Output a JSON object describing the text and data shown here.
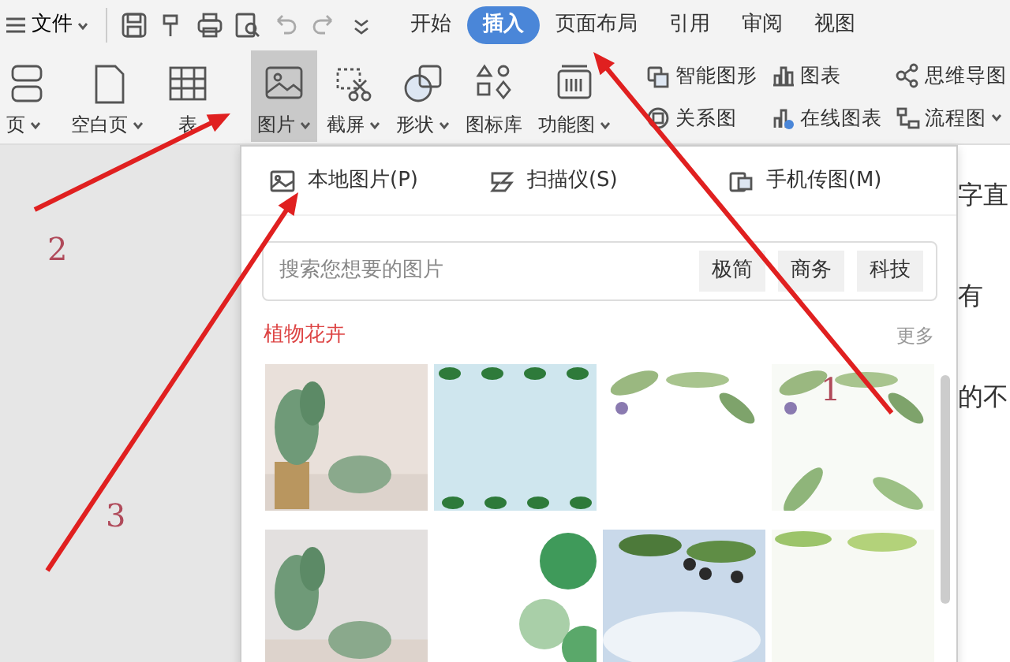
{
  "app_menu": {
    "label": "文件"
  },
  "tabs": [
    {
      "label": "开始",
      "selected": false
    },
    {
      "label": "插入",
      "selected": true
    },
    {
      "label": "页面布局",
      "selected": false
    },
    {
      "label": "引用",
      "selected": false
    },
    {
      "label": "审阅",
      "selected": false
    },
    {
      "label": "视图",
      "selected": false
    }
  ],
  "ribbon_large": [
    {
      "label": "页",
      "dropdown": true,
      "selected": false
    },
    {
      "label": "空白页",
      "dropdown": true,
      "selected": false
    },
    {
      "label": "表",
      "dropdown": false,
      "selected": false
    },
    {
      "label": "图片",
      "dropdown": true,
      "selected": true
    },
    {
      "label": "截屏",
      "dropdown": true,
      "selected": false
    },
    {
      "label": "形状",
      "dropdown": true,
      "selected": false
    },
    {
      "label": "图标库",
      "dropdown": false,
      "selected": false
    },
    {
      "label": "功能图",
      "dropdown": true,
      "selected": false
    }
  ],
  "ribbon_small": [
    {
      "label": "智能图形",
      "dropdown": false
    },
    {
      "label": "关系图",
      "dropdown": false
    },
    {
      "label": "图表",
      "dropdown": false
    },
    {
      "label": "在线图表",
      "dropdown": false
    },
    {
      "label": "思维导图",
      "dropdown": false
    },
    {
      "label": "流程图",
      "dropdown": true
    }
  ],
  "picture_menu": {
    "sources": [
      {
        "label": "本地图片(P)"
      },
      {
        "label": "扫描仪(S)"
      },
      {
        "label": "手机传图(M)"
      }
    ],
    "search": {
      "placeholder": "搜索您想要的图片",
      "tags": [
        "极简",
        "商务",
        "科技"
      ]
    },
    "section": {
      "title": "植物花卉",
      "more": "更多"
    }
  },
  "document": {
    "lines": [
      "字直",
      "有",
      "的不"
    ]
  },
  "annotations": [
    {
      "label": "1"
    },
    {
      "label": "2"
    },
    {
      "label": "3"
    }
  ]
}
